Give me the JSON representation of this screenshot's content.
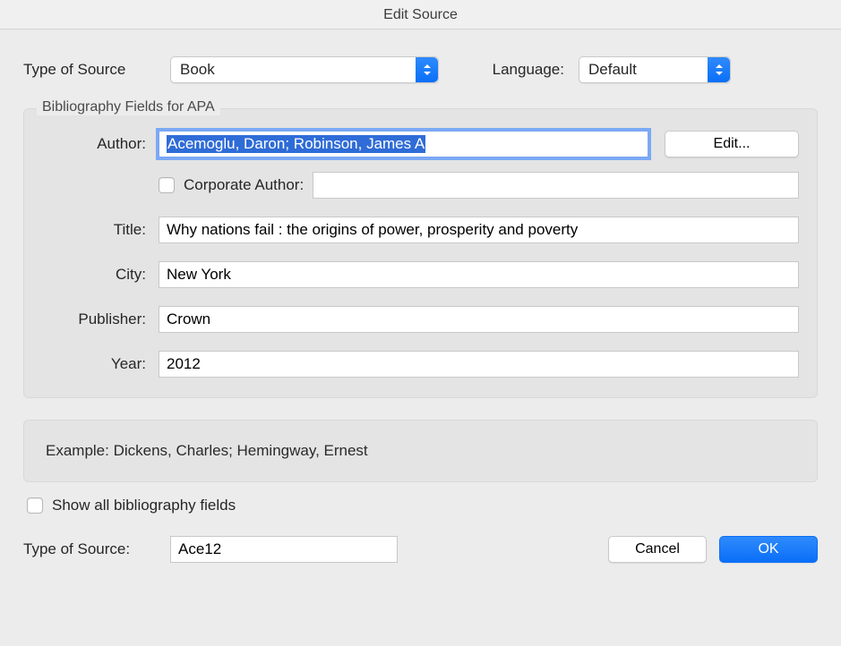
{
  "title": "Edit Source",
  "top": {
    "source_label": "Type of Source",
    "source_value": "Book",
    "language_label": "Language:",
    "language_value": "Default"
  },
  "group": {
    "legend": "Bibliography Fields for APA",
    "fields": {
      "author_label": "Author:",
      "author_value": "Acemoglu, Daron; Robinson, James A",
      "edit_button": "Edit...",
      "corp_label": "Corporate Author:",
      "corp_value": "",
      "title_label": "Title:",
      "title_value": "Why nations fail : the origins of power, prosperity and poverty",
      "city_label": "City:",
      "city_value": "New York",
      "publisher_label": "Publisher:",
      "publisher_value": "Crown",
      "year_label": "Year:",
      "year_value": "2012"
    }
  },
  "example": "Example: Dickens, Charles; Hemingway, Ernest",
  "show_all_label": "Show all bibliography fields",
  "bottom": {
    "label": "Type of Source:",
    "value": "Ace12",
    "cancel": "Cancel",
    "ok": "OK"
  }
}
